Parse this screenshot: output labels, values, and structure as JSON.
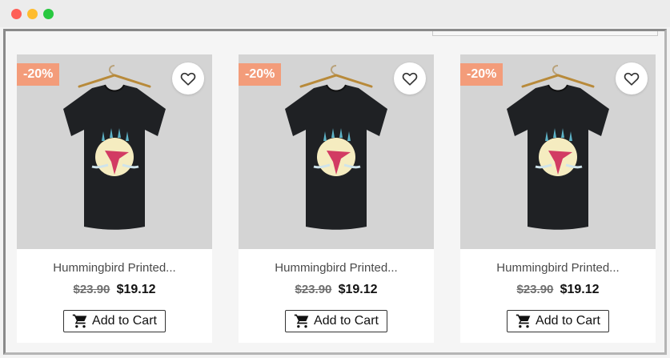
{
  "products": [
    {
      "badge": "-20%",
      "title": "Hummingbird Printed...",
      "old_price": "$23.90",
      "new_price": "$19.12",
      "cta": "Add to Cart"
    },
    {
      "badge": "-20%",
      "title": "Hummingbird Printed...",
      "old_price": "$23.90",
      "new_price": "$19.12",
      "cta": "Add to Cart"
    },
    {
      "badge": "-20%",
      "title": "Hummingbird Printed...",
      "old_price": "$23.90",
      "new_price": "$19.12",
      "cta": "Add to Cart"
    }
  ],
  "icons": {
    "wishlist": "heart-outline-icon",
    "cart": "shopping-cart-icon"
  },
  "colors": {
    "badge": "#f39c7a",
    "image_background": "#d4d4d4",
    "tshirt": "#1f2124"
  }
}
